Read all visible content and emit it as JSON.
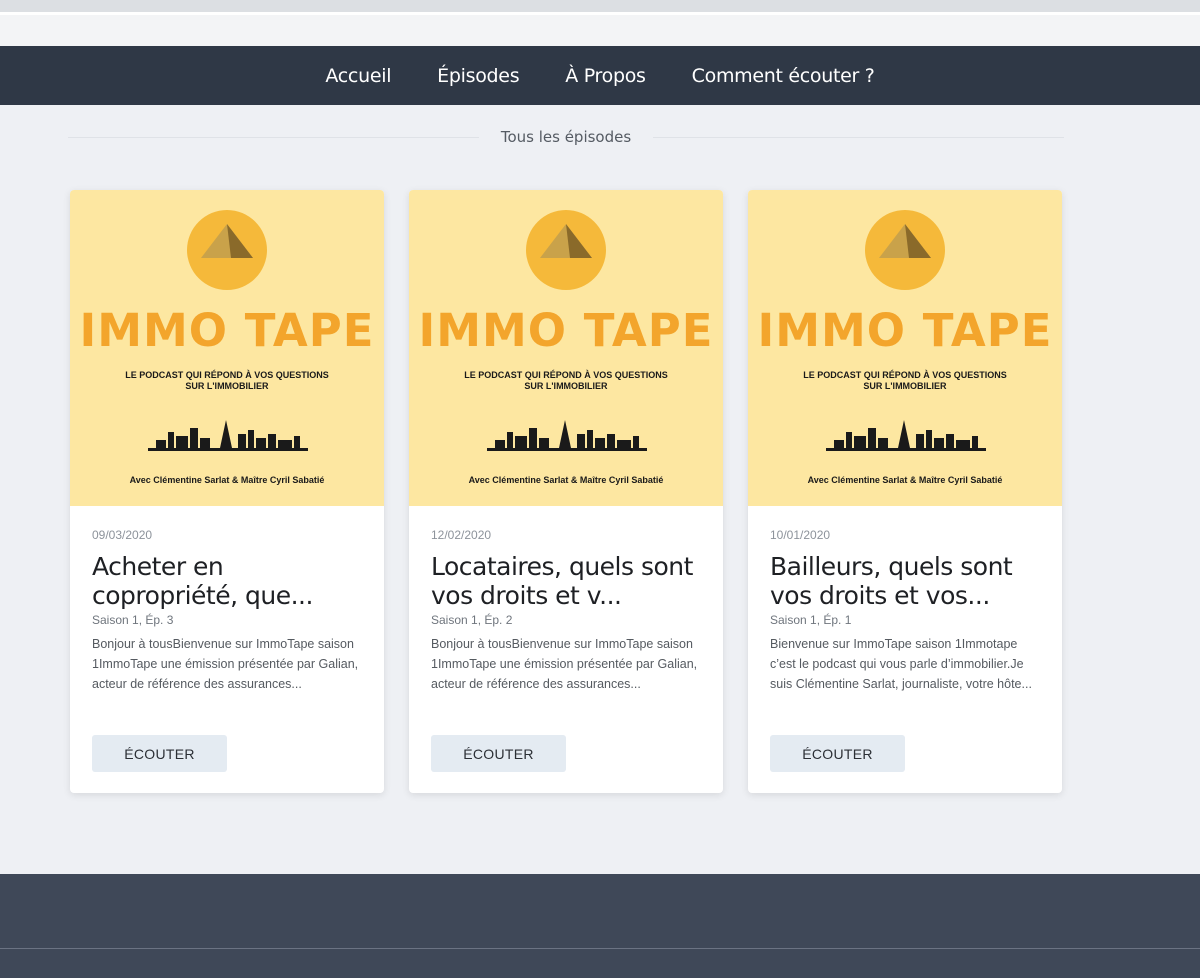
{
  "nav": {
    "items": [
      "Accueil",
      "Épisodes",
      "À Propos",
      "Comment écouter ?"
    ]
  },
  "section": {
    "title": "Tous les épisodes"
  },
  "cover": {
    "brand": "IMMO TAPE",
    "tagline": "LE PODCAST QUI RÉPOND À VOS QUESTIONS SUR L'IMMOBILIER",
    "hosts": "Avec Clémentine Sarlat & Maître Cyril Sabatié"
  },
  "episodes": [
    {
      "date": "09/03/2020",
      "title": "Acheter en copropriété, que...",
      "meta": "Saison 1, Ép. 3",
      "description": "Bonjour à tousBienvenue sur ImmoTape saison 1ImmoTape une émission présentée par Galian, acteur de référence des assurances...",
      "button": "ÉCOUTER"
    },
    {
      "date": "12/02/2020",
      "title": "Locataires, quels sont vos droits et v...",
      "meta": "Saison 1, Ép. 2",
      "description": "Bonjour à tousBienvenue sur ImmoTape saison 1ImmoTape une émission présentée par Galian, acteur de référence des assurances...",
      "button": "ÉCOUTER"
    },
    {
      "date": "10/01/2020",
      "title": "Bailleurs, quels sont vos droits et vos...",
      "meta": "Saison 1, Ép. 1",
      "description": "Bienvenue sur ImmoTape saison 1Immotape c’est le podcast qui vous parle d’immobilier.Je suis Clémentine Sarlat, journaliste, votre hôte...",
      "button": "ÉCOUTER"
    }
  ],
  "colors": {
    "navbar": "#2f3846",
    "cover_bg": "#fde7a1",
    "brand": "#f3a52c",
    "button_bg": "#e4ebf2",
    "footer": "#3f4858"
  }
}
